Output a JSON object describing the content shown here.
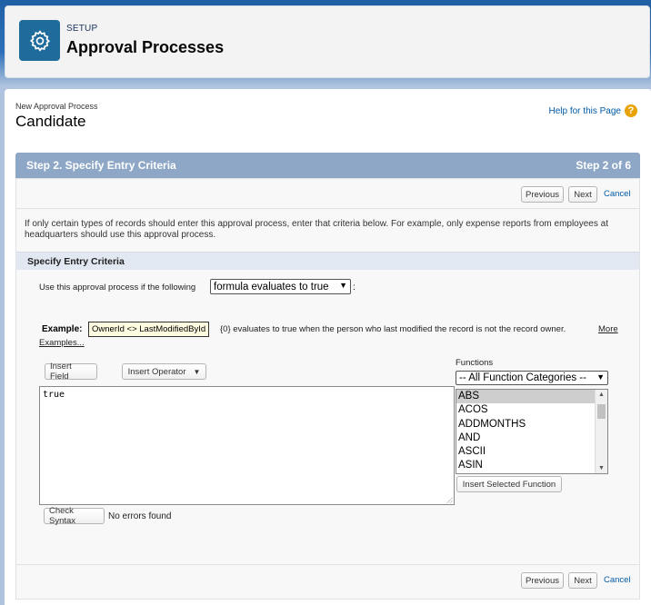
{
  "header": {
    "breadcrumb": "SETUP",
    "title": "Approval Processes",
    "icon": "gear-icon"
  },
  "page": {
    "pretitle": "New Approval Process",
    "title": "Candidate",
    "help_link": "Help for this Page",
    "help_icon": "?"
  },
  "step": {
    "label": "Step 2. Specify Entry Criteria",
    "counter": "Step 2 of 6"
  },
  "nav": {
    "previous": "Previous",
    "next": "Next",
    "cancel": "Cancel"
  },
  "description": "If only certain types of records should enter this approval process, enter that criteria below. For example, only expense reports from employees at headquarters should use this approval process.",
  "section": {
    "title": "Specify Entry Criteria",
    "use_label": "Use this approval process if the following",
    "criteria_select": "formula evaluates to true",
    "colon": ":"
  },
  "example": {
    "label": "Example:",
    "code": "OwnerId <> LastModifiedById",
    "text": "{0} evaluates to true when the person who last modified the record is not the record owner.",
    "more_link_1": "More",
    "more_link_2": "Examples..."
  },
  "editor": {
    "insert_field": "Insert Field",
    "insert_operator": "Insert Operator",
    "formula": "true",
    "check_syntax": "Check Syntax",
    "status": "No errors found"
  },
  "functions": {
    "label": "Functions",
    "category_select": "-- All Function Categories --",
    "items": [
      "ABS",
      "ACOS",
      "ADDMONTHS",
      "AND",
      "ASCII",
      "ASIN"
    ],
    "selected": "ABS",
    "insert_button": "Insert Selected Function"
  }
}
